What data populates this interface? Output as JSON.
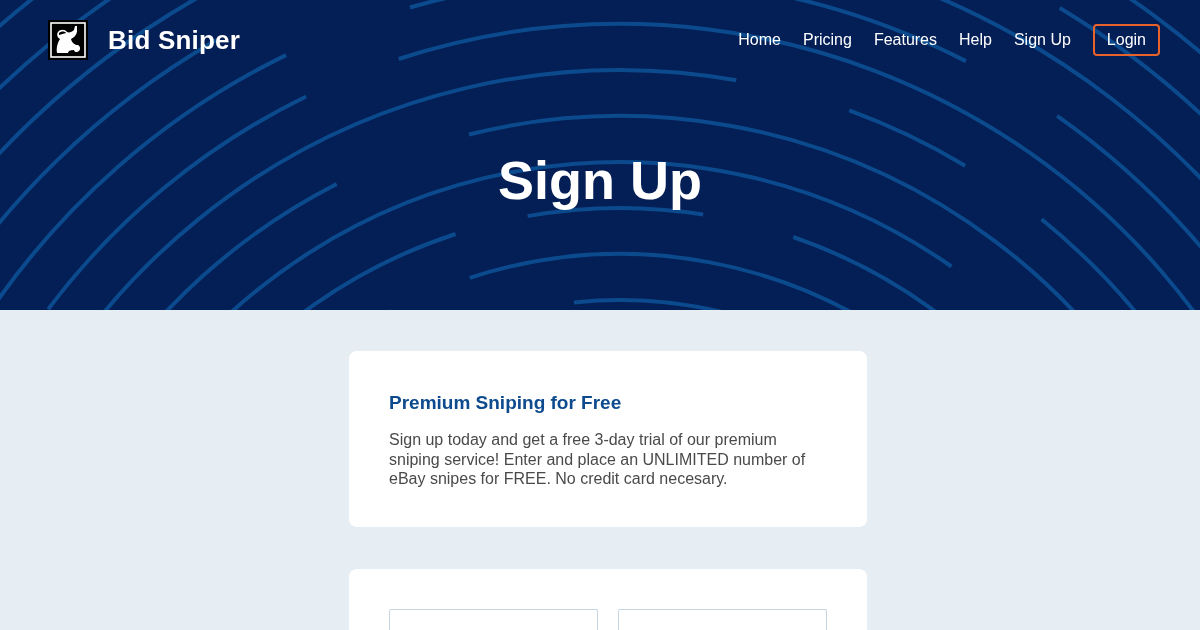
{
  "header": {
    "brand": "Bid Sniper",
    "nav": [
      {
        "label": "Home",
        "kind": "link"
      },
      {
        "label": "Pricing",
        "kind": "link"
      },
      {
        "label": "Features",
        "kind": "link"
      },
      {
        "label": "Help",
        "kind": "link"
      },
      {
        "label": "Sign Up",
        "kind": "link"
      },
      {
        "label": "Login",
        "kind": "outlined"
      }
    ]
  },
  "hero": {
    "title": "Sign Up"
  },
  "promo_card": {
    "title": "Premium Sniping for Free",
    "text": "Sign up today and get a free 3-day trial of our premium sniping service! Enter and place an UNLIMITED number of eBay snipes for FREE. No credit card necesary."
  },
  "signup_form": {
    "fields": [
      {
        "kind": "input"
      },
      {
        "kind": "input"
      }
    ]
  }
}
